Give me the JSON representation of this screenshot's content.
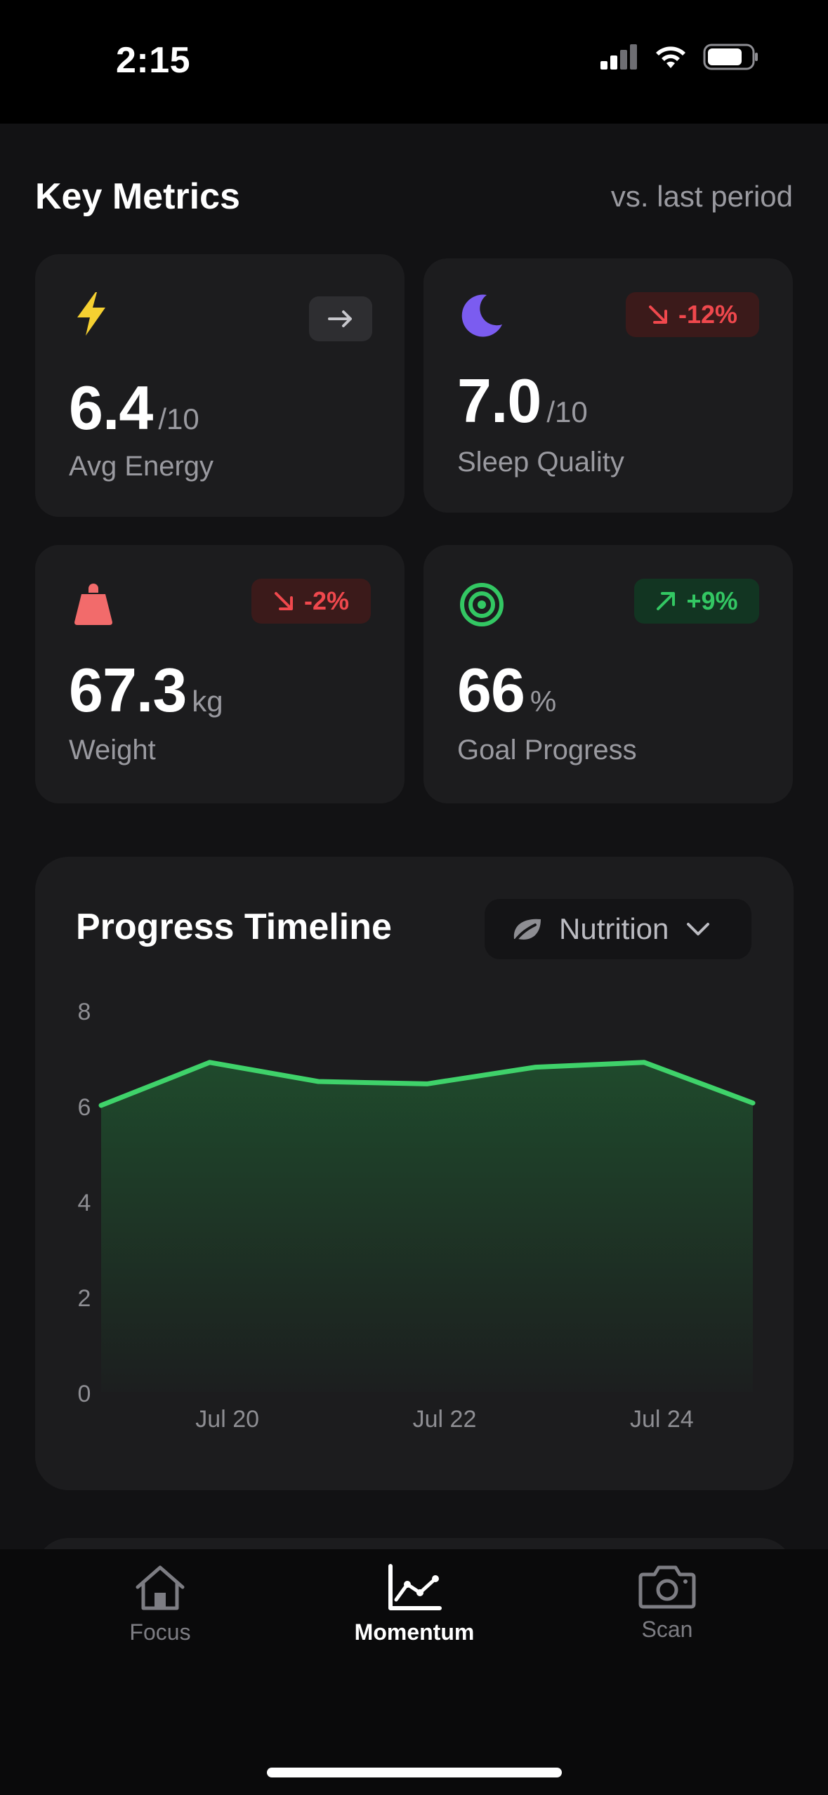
{
  "status_bar": {
    "time": "2:15"
  },
  "metrics_section": {
    "title": "Key Metrics",
    "subtitle": "vs. last period"
  },
  "metrics": [
    {
      "icon": "lightning-icon",
      "trend_icon": "arrow-right-icon",
      "trend": "",
      "value": "6.4",
      "unit": "/10",
      "label": "Avg Energy"
    },
    {
      "icon": "moon-icon",
      "trend_icon": "arrow-down-right-icon",
      "trend": "-12%",
      "value": "7.0",
      "unit": "/10",
      "label": "Sleep Quality"
    },
    {
      "icon": "weight-icon",
      "trend_icon": "arrow-down-right-icon",
      "trend": "-2%",
      "value": "67.3",
      "unit": "kg",
      "label": "Weight"
    },
    {
      "icon": "target-icon",
      "trend_icon": "arrow-up-right-icon",
      "trend": "+9%",
      "value": "66",
      "unit": "%",
      "label": "Goal Progress"
    }
  ],
  "timeline": {
    "title": "Progress Timeline",
    "dropdown": {
      "icon": "leaf-icon",
      "selected": "Nutrition"
    }
  },
  "chart_data": {
    "type": "area",
    "title": "Progress Timeline",
    "x": [
      "Jul 19",
      "Jul 20",
      "Jul 21",
      "Jul 22",
      "Jul 23",
      "Jul 24",
      "Jul 25"
    ],
    "x_tick_labels": [
      "Jul 20",
      "Jul 22",
      "Jul 24"
    ],
    "series": [
      {
        "values": [
          6.0,
          6.9,
          6.5,
          6.45,
          6.8,
          6.9,
          6.05
        ]
      }
    ],
    "y_ticks": [
      0,
      2,
      4,
      6,
      8
    ],
    "ylim": [
      0,
      8
    ],
    "grid": false,
    "colors": {
      "line": "#3fd26a",
      "fill": "#1f4a2c"
    }
  },
  "tabs": [
    {
      "icon": "home-icon",
      "label": "Focus",
      "active": false
    },
    {
      "icon": "chart-icon",
      "label": "Momentum",
      "active": true
    },
    {
      "icon": "camera-icon",
      "label": "Scan",
      "active": false
    }
  ],
  "colors": {
    "accent_green": "#33c763",
    "negative_red": "#f0484d",
    "energy_yellow": "#f5d031",
    "sleep_purple": "#7b5cf0",
    "weight_red": "#f26b6b"
  }
}
